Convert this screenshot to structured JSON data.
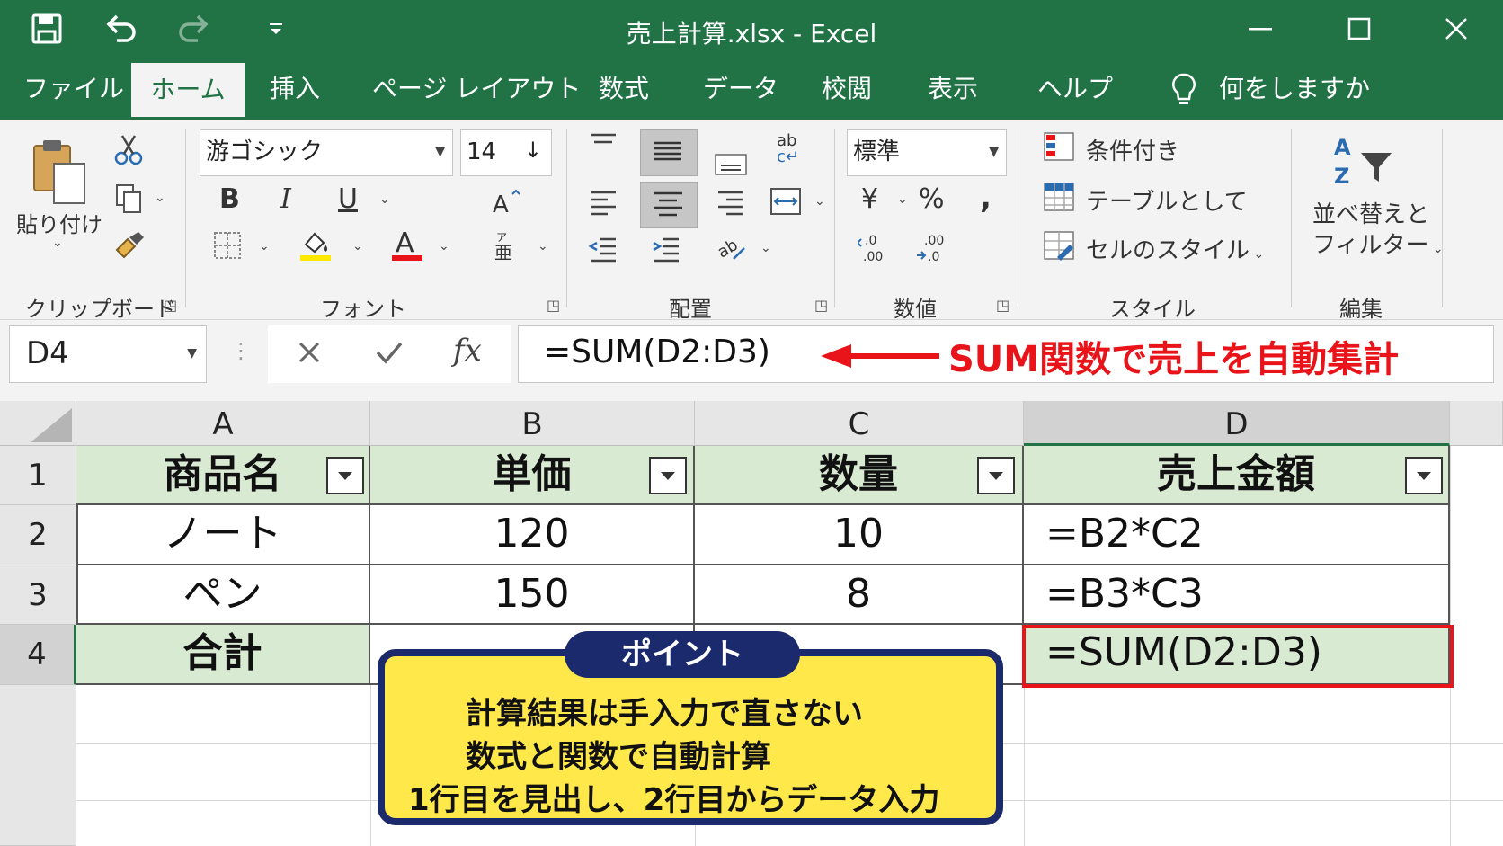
{
  "window": {
    "title": "売上計算.xlsx  -  Excel"
  },
  "tabs": [
    {
      "label": "ファイル"
    },
    {
      "label": "ホーム"
    },
    {
      "label": "挿入"
    },
    {
      "label": "ページ レイアウト"
    },
    {
      "label": "数式"
    },
    {
      "label": "データ"
    },
    {
      "label": "校閲"
    },
    {
      "label": "表示"
    },
    {
      "label": "ヘルプ"
    }
  ],
  "tell_me": "何をしますか",
  "ribbon": {
    "clipboard": {
      "paste_label": "貼り付け",
      "group_label": "クリップボード"
    },
    "font": {
      "font_name": "游ゴシック",
      "font_size": "14",
      "group_label": "フォント",
      "bold": "B",
      "italic": "I",
      "underline": "U",
      "font_color": "A"
    },
    "alignment": {
      "group_label": "配置"
    },
    "number": {
      "format": "標準",
      "currency": "¥",
      "percent": "%",
      "comma": ",",
      "group_label": "数値"
    },
    "styles": {
      "conditional": "条件付き",
      "table": "テーブルとして",
      "cell_styles": "セルのスタイル",
      "group_label": "スタイル"
    },
    "editing": {
      "sort_line1": "並べ替えと",
      "sort_line2": "フィルター",
      "group_label": "編集"
    }
  },
  "formula_bar": {
    "name_box": "D4",
    "formula": "=SUM(D2:D3)",
    "fx": "fx"
  },
  "annotation": {
    "text": "SUM関数で売上を自動集計",
    "color": "#e8141a"
  },
  "sheet": {
    "columns": [
      "A",
      "B",
      "C",
      "D"
    ],
    "rows": [
      "1",
      "2",
      "3",
      "4"
    ],
    "headers": [
      "商品名",
      "単価",
      "数量",
      "売上金額"
    ],
    "data": [
      [
        "ノート",
        "120",
        "10",
        "=B2*C2"
      ],
      [
        "ペン",
        "150",
        "8",
        "=B3*C3"
      ],
      [
        "合計",
        "",
        "",
        "=SUM(D2:D3)"
      ]
    ]
  },
  "callout": {
    "tag": "ポイント",
    "lines": [
      "計算結果は手入力で直さない",
      "数式と関数で自動計算",
      "1行目を見出し、2行目からデータ入力"
    ]
  },
  "colors": {
    "excel_green": "#217346",
    "header_fill": "#d9ead3",
    "callout_fill": "#ffe84a",
    "callout_border": "#1a2a6c",
    "selection_red": "#e8141a"
  }
}
